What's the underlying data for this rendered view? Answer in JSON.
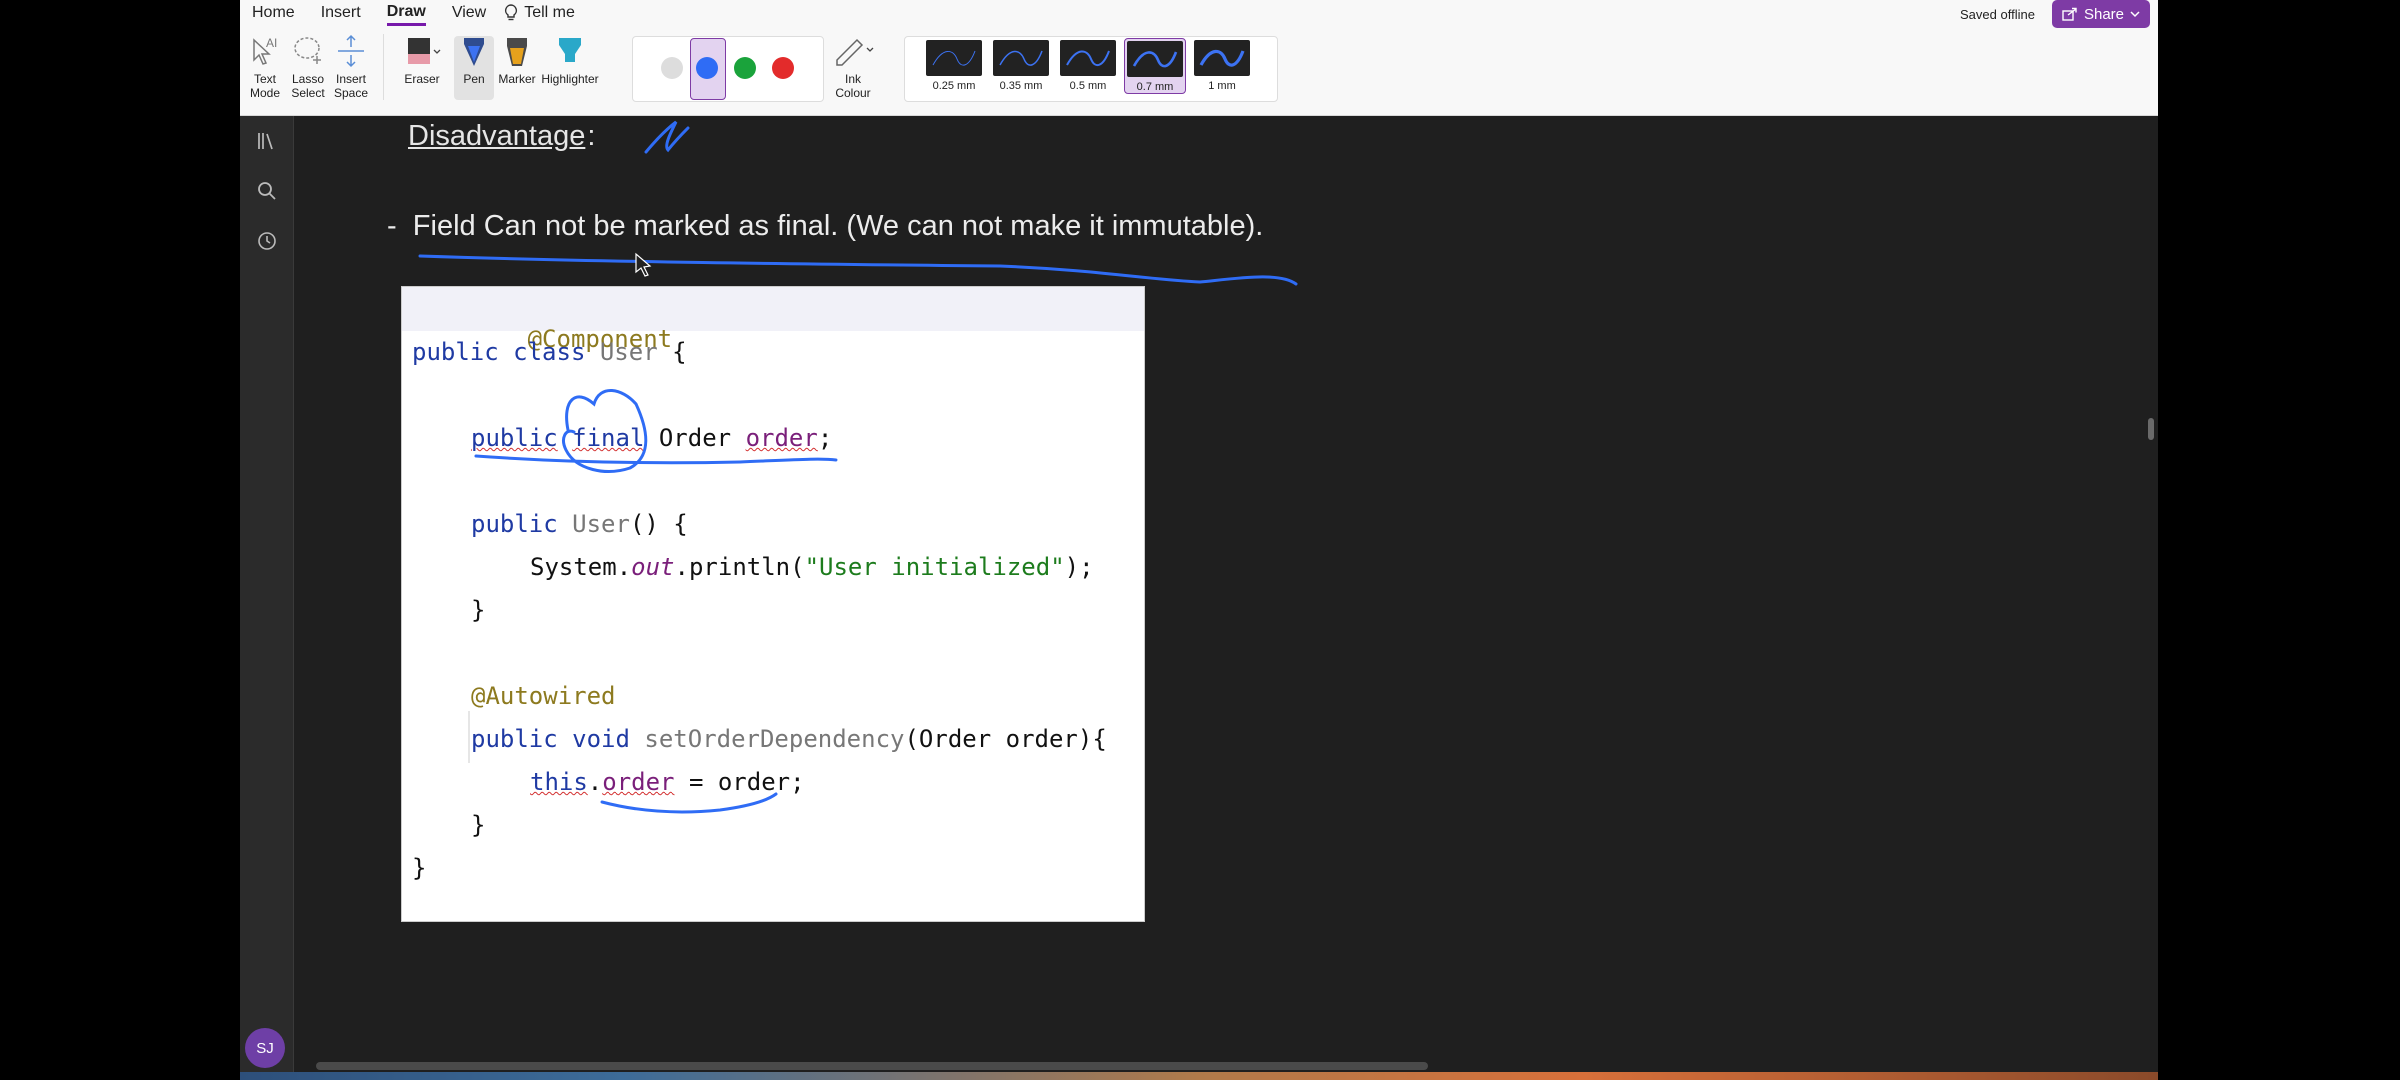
{
  "ribbon": {
    "tabs": [
      "Home",
      "Insert",
      "Draw",
      "View"
    ],
    "active_tab": "Draw",
    "tell_me": "Tell me",
    "status": "Saved offline",
    "share_label": "Share",
    "tools": {
      "text_mode": [
        "Text",
        "Mode"
      ],
      "lasso_select": [
        "Lasso",
        "Select"
      ],
      "insert_space": [
        "Insert",
        "Space"
      ],
      "eraser": "Eraser",
      "pen": "Pen",
      "marker": "Marker",
      "highlighter": "Highlighter",
      "ink_colour": [
        "Ink",
        "Colour"
      ]
    },
    "colors": [
      "#dddddd",
      "#2f6cf5",
      "#1aa33b",
      "#e32b2b"
    ],
    "selected_color": "#2f6cf5",
    "thickness": [
      "0.25 mm",
      "0.35 mm",
      "0.5 mm",
      "0.7 mm",
      "1 mm"
    ],
    "selected_thickness": "0.7 mm"
  },
  "sidebar": {
    "avatar_initials": "SJ"
  },
  "page": {
    "heading": "Disadvantage",
    "heading_suffix": ":",
    "bullet_dash": "-",
    "bullet_text": "Field Can not be marked as final. (We can not make it immutable)."
  },
  "code": {
    "l1_ann": "@Component",
    "l2_kw": "public class ",
    "l2_cls": "User",
    "l2_rest": " {",
    "l3_kw1": "public",
    "l3_kw2": "final",
    "l3_type": " Order ",
    "l3_fld": "order",
    "l3_end": ";",
    "l4_kw": "public ",
    "l4_name": "User",
    "l4_rest": "() {",
    "l5_a": "System.",
    "l5_out": "out",
    "l5_b": ".println(",
    "l5_str": "\"User initialized\"",
    "l5_c": ");",
    "l6": "}",
    "l7_ann": "@Autowired",
    "l8_kw": "public void ",
    "l8_meth": "setOrderDependency",
    "l8_rest": "(Order order){",
    "l9_this": "this",
    "l9_dot": ".",
    "l9_fld": "order",
    "l9_rest": " = order;",
    "l10": "}",
    "l11": "}"
  },
  "colors": {
    "accent": "#7e3ba5",
    "ink": "#2f6cf5"
  }
}
